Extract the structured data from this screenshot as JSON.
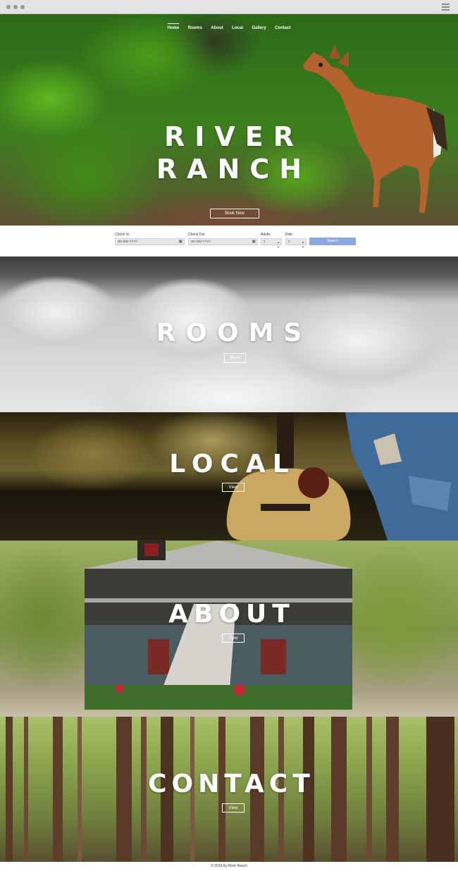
{
  "nav": {
    "items": [
      {
        "label": "Home",
        "active": true
      },
      {
        "label": "Rooms"
      },
      {
        "label": "About"
      },
      {
        "label": "Local"
      },
      {
        "label": "Gallery"
      },
      {
        "label": "Contact"
      }
    ]
  },
  "hero": {
    "title_line1": "RIVER",
    "title_line2": "RANCH",
    "button_label": "Book Now"
  },
  "booking": {
    "check_in_label": "Check In",
    "check_in_placeholder": "DD MM YYYY",
    "check_out_label": "Check Out",
    "check_out_placeholder": "DD MM YYYY",
    "adults_label": "Adults",
    "adults_value": "1",
    "kids_label": "Kids",
    "kids_value": "0",
    "search_label": "Search"
  },
  "rooms": {
    "title": "ROOMS",
    "button_label": "Book"
  },
  "local": {
    "title": "LOCAL",
    "button_label": "View"
  },
  "about": {
    "title": "ABOUT",
    "button_label": "View"
  },
  "contact": {
    "title": "CONTACT",
    "button_label": "View"
  },
  "footer": {
    "text": "© 2016 by River Ranch"
  },
  "colors": {
    "search_button": "#90a8e0",
    "text_on_image": "#ffffff"
  }
}
